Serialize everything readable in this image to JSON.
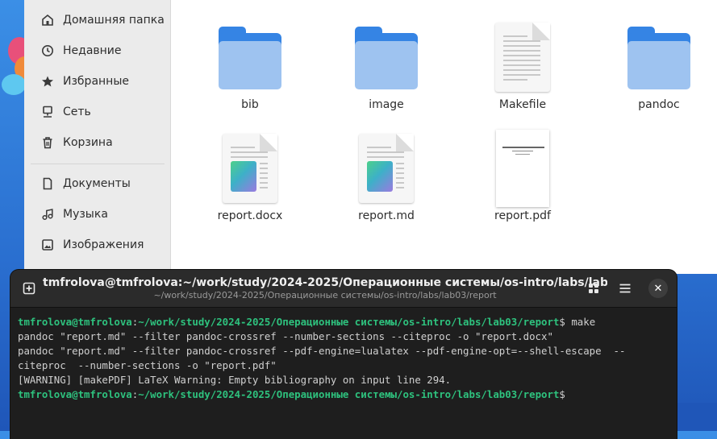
{
  "sidebar": {
    "items": [
      {
        "label": "Домашняя папка",
        "icon": "home-icon"
      },
      {
        "label": "Недавние",
        "icon": "clock-icon"
      },
      {
        "label": "Избранные",
        "icon": "star-icon"
      },
      {
        "label": "Сеть",
        "icon": "network-icon"
      },
      {
        "label": "Корзина",
        "icon": "trash-icon"
      },
      {
        "label": "Документы",
        "icon": "document-icon"
      },
      {
        "label": "Музыка",
        "icon": "music-icon"
      },
      {
        "label": "Изображения",
        "icon": "image-icon"
      }
    ]
  },
  "files": [
    {
      "name": "bib",
      "kind": "folder"
    },
    {
      "name": "image",
      "kind": "folder"
    },
    {
      "name": "Makefile",
      "kind": "text"
    },
    {
      "name": "pandoc",
      "kind": "folder"
    },
    {
      "name": "report.docx",
      "kind": "doc"
    },
    {
      "name": "report.md",
      "kind": "doc"
    },
    {
      "name": "report.pdf",
      "kind": "pdf"
    }
  ],
  "terminal": {
    "title": "tmfrolova@tmfrolova:~/work/study/2024-2025/Операционные системы/os-intro/labs/lab...",
    "subtitle": "~/work/study/2024-2025/Операционные системы/os-intro/labs/lab03/report",
    "prompt_user": "tmfrolova@tmfrolova",
    "prompt_path": "~/work/study/2024-2025/Операционные системы/os-intro/labs/lab03/report",
    "command": " make",
    "output": [
      "pandoc \"report.md\" --filter pandoc-crossref --number-sections --citeproc -o \"report.docx\"",
      "pandoc \"report.md\" --filter pandoc-crossref --pdf-engine=lualatex --pdf-engine-opt=--shell-escape  --",
      "citeproc  --number-sections -o \"report.pdf\"",
      "[WARNING] [makePDF] LaTeX Warning: Empty bibliography on input line 294."
    ]
  },
  "colors": {
    "accent": "#3584e4",
    "prompt": "#2ec27e",
    "terminal_bg": "#1e1e1e"
  }
}
